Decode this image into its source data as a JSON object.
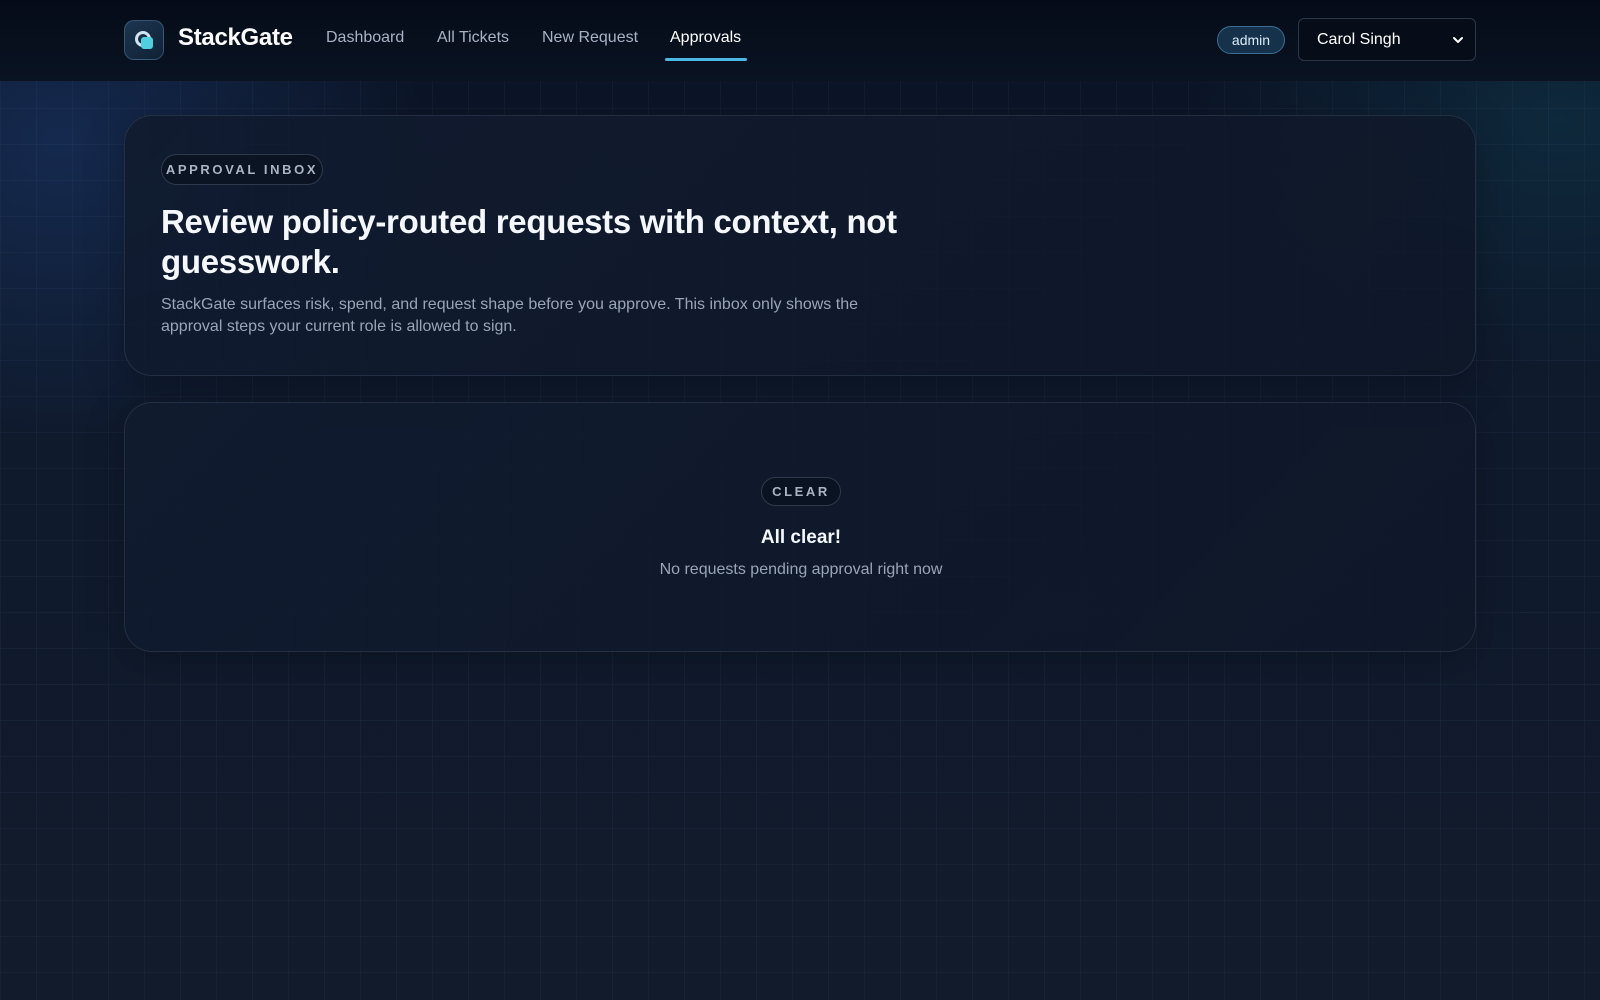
{
  "app": {
    "brand": "StackGate"
  },
  "nav": {
    "items": [
      {
        "label": "Dashboard"
      },
      {
        "label": "All Tickets"
      },
      {
        "label": "New Request"
      },
      {
        "label": "Approvals",
        "active": true
      }
    ]
  },
  "user": {
    "role": "admin",
    "selected": "Carol Singh"
  },
  "hero": {
    "eyebrow": "APPROVAL INBOX",
    "title": "Review policy-routed requests with context, not guesswork.",
    "description": "StackGate surfaces risk, spend, and request shape before you approve. This inbox only shows the approval steps your current role is allowed to sign."
  },
  "empty_state": {
    "tag": "CLEAR",
    "title": "All clear!",
    "subtitle": "No requests pending approval right now"
  },
  "colors": {
    "accent": "#4cb8e6",
    "background": "#0f1a2d",
    "logo_accent": "#4fd0e0"
  },
  "icons": {
    "logo": "stackgate-logo-icon",
    "select": "chevron-down-icon"
  }
}
